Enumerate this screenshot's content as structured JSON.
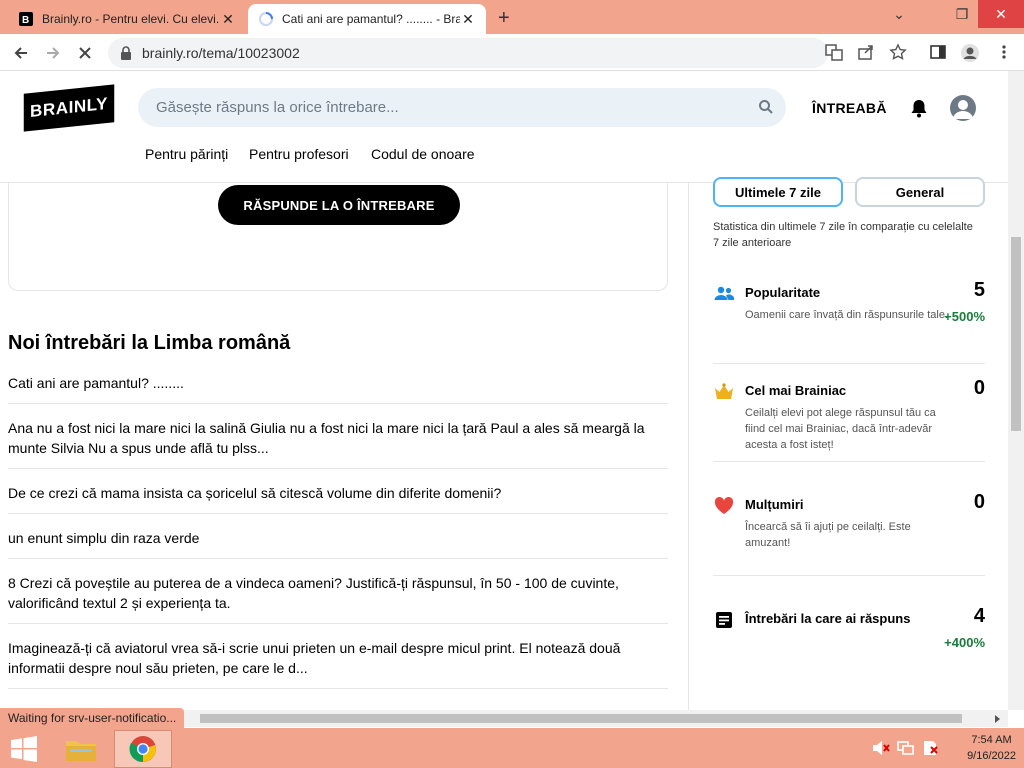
{
  "browser": {
    "tabs": [
      {
        "title": "Brainly.ro - Pentru elevi. Cu elevi.",
        "close": "✕"
      },
      {
        "title": "Cati ani are pamantul? ........ - Brainly.ro",
        "close": "✕"
      }
    ],
    "new_tab": "+",
    "window_controls": [
      "⌄",
      "❐",
      "✕"
    ],
    "url": "brainly.ro/tema/10023002"
  },
  "header": {
    "logo": "BRAINLY",
    "search_placeholder": "Găsește răspuns la orice întrebare...",
    "ask_label": "ÎNTREABĂ",
    "subnav": [
      "Pentru părinți",
      "Pentru profesori",
      "Codul de onoare"
    ]
  },
  "main": {
    "answer_button": "RĂSPUNDE LA O ÎNTREBARE",
    "section_title": "Noi întrebări la Limba română",
    "questions": [
      "Cati ani are pamantul? ........",
      "Ana nu a fost nici la mare nici la salină Giulia nu a fost nici la mare nici la țară Paul a ales să meargă la munte Silvia Nu a spus unde află tu plss...",
      "De ce crezi că mama insista ca șoricelul să citescă volume din diferite domenii?",
      "un enunt simplu din raza verde",
      "8 Crezi că poveștile au puterea de a vindeca oameni? Justifică-ți răspunsul, în 50 - 100 de cuvinte, valorificând textul 2 și experiența ta.",
      "Imaginează-ți că aviatorul vrea să-i scrie unui prieten un e-mail despre micul print. El notează două informatii despre noul său prieten, pe care le d..."
    ]
  },
  "sidebar": {
    "tabs": [
      "Ultimele 7 zile",
      "General"
    ],
    "note": "Statistica din ultimele 7 zile în comparație cu celelalte 7 zile anterioare",
    "stats": [
      {
        "label": "Popularitate",
        "desc": "Oamenii care învață din răspunsurile tale.",
        "value": "5",
        "delta": "+500%",
        "icon": "people-icon"
      },
      {
        "label": "Cel mai Brainiac",
        "desc": "Ceilalți elevi pot alege răspunsul tău ca fiind cel mai Brainiac, dacă într-adevăr acesta a fost isteț!",
        "value": "0",
        "delta": "",
        "icon": "crown-icon"
      },
      {
        "label": "Mulțumiri",
        "desc": "Încearcă să îi ajuți pe ceilalți. Este amuzant!",
        "value": "0",
        "delta": "",
        "icon": "heart-icon"
      },
      {
        "label": "Întrebări la care ai răspuns",
        "desc": "",
        "value": "4",
        "delta": "+400%",
        "icon": "questions-icon"
      }
    ]
  },
  "status_bar": "Waiting for srv-user-notificatio...",
  "taskbar": {
    "time": "7:54 AM",
    "date": "9/16/2022"
  },
  "colors": {
    "accent": "#f2a58c",
    "positive": "#1a7b3c",
    "active_tab_border": "#4fb3f6"
  }
}
